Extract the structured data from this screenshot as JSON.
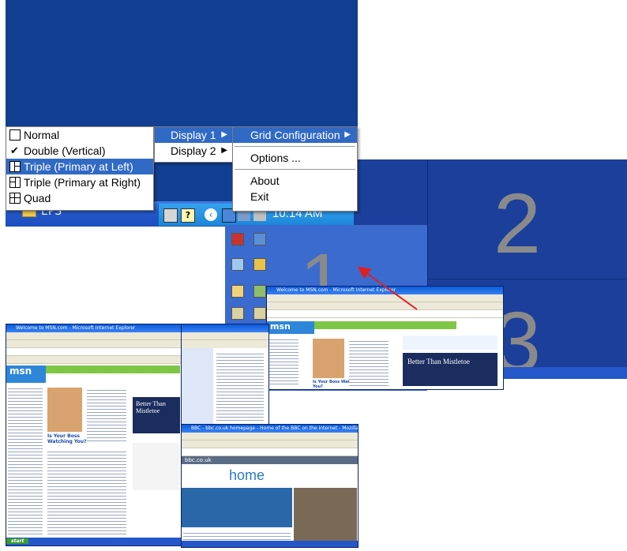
{
  "menus": {
    "grid_configuration": {
      "items": [
        {
          "label": "Normal",
          "state": "box"
        },
        {
          "label": "Double (Vertical)",
          "state": "checked"
        },
        {
          "label": "Triple (Primary at Left)",
          "state": "selected"
        },
        {
          "label": "Triple (Primary at Right)",
          "state": "box"
        },
        {
          "label": "Quad",
          "state": "box"
        }
      ]
    },
    "display": {
      "items": [
        {
          "label": "Display 1",
          "has_submenu": true,
          "state": "selected"
        },
        {
          "label": "Display 2",
          "has_submenu": true
        }
      ]
    },
    "main": {
      "grid_label": "Grid Configuration",
      "options_label": "Options ...",
      "about_label": "About",
      "exit_label": "Exit"
    }
  },
  "taskbar": {
    "app_label": "EPS",
    "clock": "10:14 AM"
  },
  "monitors": {
    "labels": [
      "1",
      "2",
      "3"
    ]
  },
  "screens": {
    "msn_title": "Welcome to MSN.com - Microsoft Internet Explorer",
    "bbc_title": "BBC - bbc.co.uk homepage - Home of the BBC on the Internet - Mozilla",
    "msn_logo": "msn",
    "bbc_logo": "bbc.co.uk",
    "bbc_home": "home",
    "headline": "Is Your Boss Watching You?",
    "ad_text": "Better Than Mistletoe",
    "start_label": "start"
  },
  "colors": {
    "desktop_blue": "#123f91",
    "menu_highlight": "#316ac5",
    "arrow": "#e02020",
    "number_gray": "#8a8a8a"
  }
}
